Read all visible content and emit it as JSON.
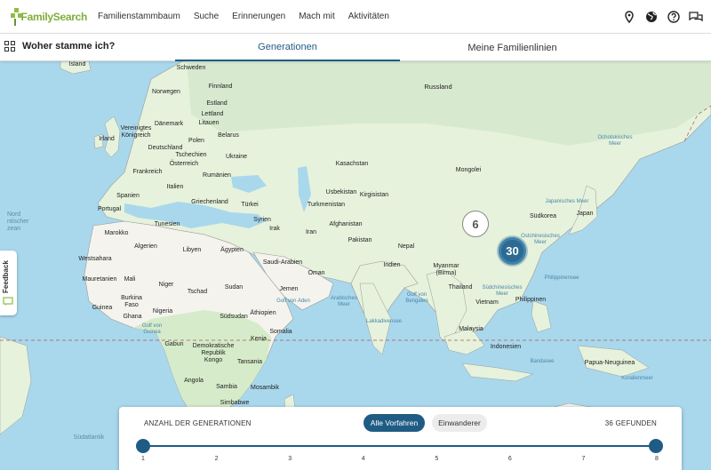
{
  "brand": "FamilySearch",
  "nav": [
    "Familienstammbaum",
    "Suche",
    "Erinnerungen",
    "Mach mit",
    "Aktivitäten"
  ],
  "nav_icons": [
    "location-icon",
    "globe-icon",
    "help-icon",
    "chat-icon"
  ],
  "subbar": {
    "title": "Woher stamme ich?",
    "tabs": [
      "Generationen",
      "Meine Familienlinien"
    ],
    "active_tab": "Generationen"
  },
  "map": {
    "labels": {
      "island": "Island",
      "schweden": "Schweden",
      "finnland": "Finnland",
      "norwegen": "Norwegen",
      "russland": "Russland",
      "estland": "Estland",
      "lettland": "Lettland",
      "litauen": "Litauen",
      "daenemark": "Dänemark",
      "vk": "Vereinigtes\nKönigreich",
      "irland": "Irland",
      "deutschland": "Deutschland",
      "polen": "Polen",
      "belarus": "Belarus",
      "ukraine": "Ukraine",
      "tschechien": "Tschechien",
      "oesterreich": "Österreich",
      "frankreich": "Frankreich",
      "rumaenien": "Rumänien",
      "kasachstan": "Kasachstan",
      "mongolei": "Mongolei",
      "usbekistan": "Usbekistan",
      "kirgisistan": "Kirgisistan",
      "italien": "Italien",
      "spanien": "Spanien",
      "portugal": "Portugal",
      "griechenland": "Griechenland",
      "tuerkei": "Türkei",
      "turkmenistan": "Turkmenistan",
      "syrien": "Syrien",
      "irak": "Irak",
      "iran": "Iran",
      "afghanistan": "Afghanistan",
      "pakistan": "Pakistan",
      "tunesien": "Tunesien",
      "marokko": "Marokko",
      "algerien": "Algerien",
      "libyen": "Libyen",
      "aegypten": "Ägypten",
      "westsahara": "Westsahara",
      "saudi": "Saudi-Arabien",
      "nepal": "Nepal",
      "indien": "Indien",
      "myanmar": "Myanmar\n(Birma)",
      "thailand": "Thailand",
      "vietnam": "Vietnam",
      "philippinen": "Philippinen",
      "malaysia": "Malaysia",
      "indonesien": "Indonesien",
      "papua": "Papua-Neuguinea",
      "suedkorea": "Südkorea",
      "japan": "Japan",
      "mauretanien": "Mauretanien",
      "mali": "Mali",
      "niger": "Niger",
      "tschad": "Tschad",
      "sudan": "Sudan",
      "oman": "Oman",
      "jemen": "Jemen",
      "burkina": "Burkina\nFaso",
      "guinea": "Guinea",
      "ghana": "Ghana",
      "nigeria": "Nigeria",
      "suedsudan": "Südsudan",
      "aethiopien": "Äthiopien",
      "somalia": "Somalia",
      "kenia": "Kenia",
      "gabun": "Gabun",
      "drkongo": "Demokratische\nRepublik\nKongo",
      "tansania": "Tansania",
      "angola": "Angola",
      "sambia": "Sambia",
      "mosambik": "Mosambik",
      "simbabwe": "Simbabwe",
      "ochotskisches": "Ochotskisches\nMeer",
      "japanisches": "Japanisches Meer",
      "ostchinesisches": "Ostchinesisches\nMeer",
      "philippinensee": "Philippinensee",
      "suedchinesisches": "Südchinesisches\nMeer",
      "arabisches": "Arabisches\nMeer",
      "golfbengalen": "Golf von\nBengalen",
      "lakkadivensee": "Lakkadivensee",
      "golfguinea": "Golf von\nGuinea",
      "golfaden": "Golf von Aden",
      "nordatlantik": "Nord\nntischer\nzean",
      "suedatlantik": "Südatlantik",
      "korallenmeer": "Korallenmeer",
      "bandasee": "Bandasee"
    },
    "clusters": [
      {
        "name": "cluster-china",
        "count": "6"
      },
      {
        "name": "cluster-east-china-sea",
        "count": "30"
      }
    ]
  },
  "feedback_label": "Feedback",
  "panel": {
    "label": "ANZAHL DER GENERATIONEN",
    "filters": [
      "Alle Vorfahren",
      "Einwanderer"
    ],
    "active_filter": "Alle Vorfahren",
    "found": "36 GEFUNDEN",
    "ticks": [
      "1",
      "2",
      "3",
      "4",
      "5",
      "6",
      "7",
      "8"
    ],
    "range": [
      1,
      8
    ]
  },
  "colors": {
    "accent": "#1f5c85",
    "brand_green": "#7fae3b",
    "water": "#a9d8ec",
    "land": "#e6f2dc",
    "desert": "#f4f3ed"
  }
}
